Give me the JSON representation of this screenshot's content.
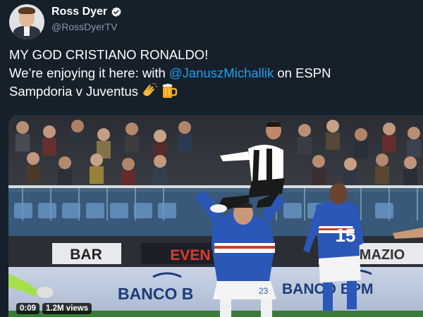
{
  "user": {
    "display_name": "Ross Dyer",
    "handle": "@RossDyerTV",
    "avatar_icon": "profile-photo",
    "verified_icon": "verified-badge-icon"
  },
  "tweet": {
    "line1": "MY GOD CRISTIANO RONALDO!",
    "line2_prefix": "We’re enjoying it here: with ",
    "mention": "@JanuszMichallik",
    "line2_suffix": " on ESPN",
    "line3": "Sampdoria v Juventus",
    "emojis": [
      "clapping-hands-icon",
      "beer-mug-icon"
    ]
  },
  "media": {
    "ad_boards": {
      "top_left": "BAR",
      "top_middle": "EVEN",
      "top_right": "MAZIO",
      "bottom_left": "BANCO B",
      "bottom_right": "BANCO BPM"
    },
    "player_numbers": {
      "jumping_player": "23",
      "right_player": "15"
    },
    "duration": "0:09",
    "views": "1.2M views"
  },
  "colors": {
    "background": "#15202b",
    "accent": "#1da1f2",
    "secondary_text": "#8899a6",
    "sampdoria_blue": "#2a57b8",
    "juventus_black": "#1a1a1a"
  }
}
